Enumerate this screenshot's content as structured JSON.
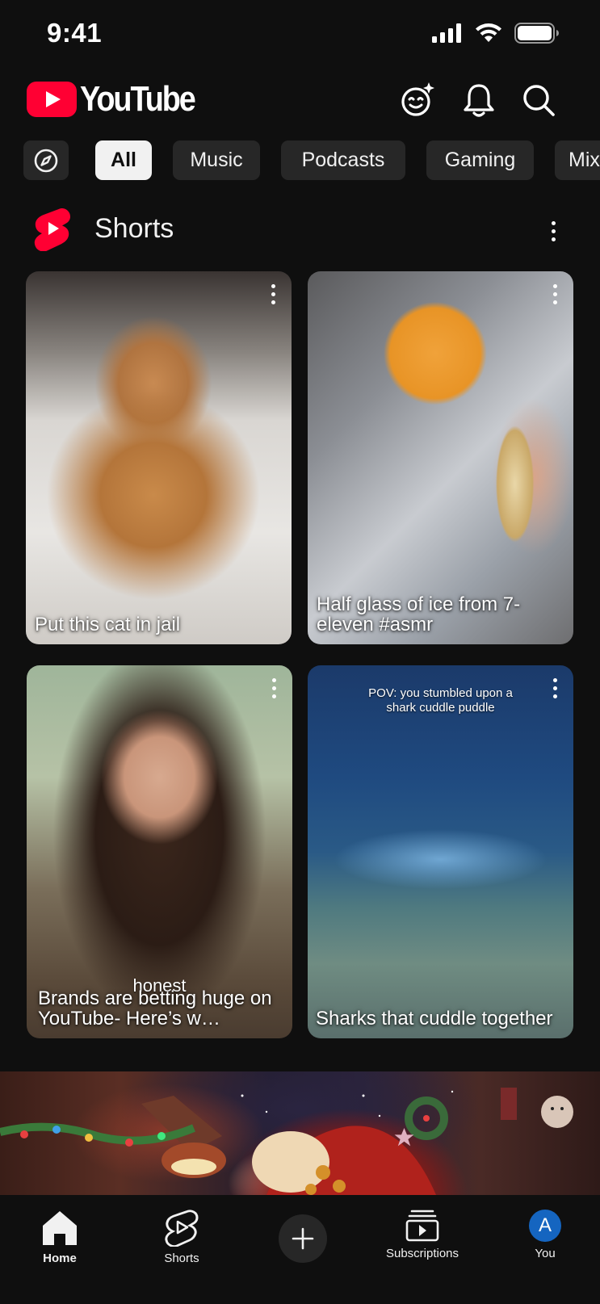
{
  "status_bar": {
    "time": "9:41"
  },
  "header": {
    "logo_text": "YouTube"
  },
  "chips": [
    {
      "label": "All"
    },
    {
      "label": "Music"
    },
    {
      "label": "Podcasts"
    },
    {
      "label": "Gaming"
    },
    {
      "label": "Mix"
    }
  ],
  "shorts": {
    "title": "Shorts",
    "items": [
      {
        "title": "Put this cat in jail"
      },
      {
        "title": "Half glass of ice from 7-eleven #asmr"
      },
      {
        "title": "Brands are betting huge on YouTube- Here’s w…",
        "overlay": "honest"
      },
      {
        "title": "Sharks that cuddle together",
        "overlay": "POV: you stumbled upon a shark cuddle puddle"
      }
    ]
  },
  "bottom_nav": {
    "home": "Home",
    "shorts": "Shorts",
    "subscriptions": "Subscriptions",
    "you": "You",
    "avatar_letter": "A"
  },
  "colors": {
    "brand_red": "#ff0033",
    "background": "#0f0f0f",
    "chip_bg": "#272727",
    "avatar_blue": "#1565c0"
  }
}
